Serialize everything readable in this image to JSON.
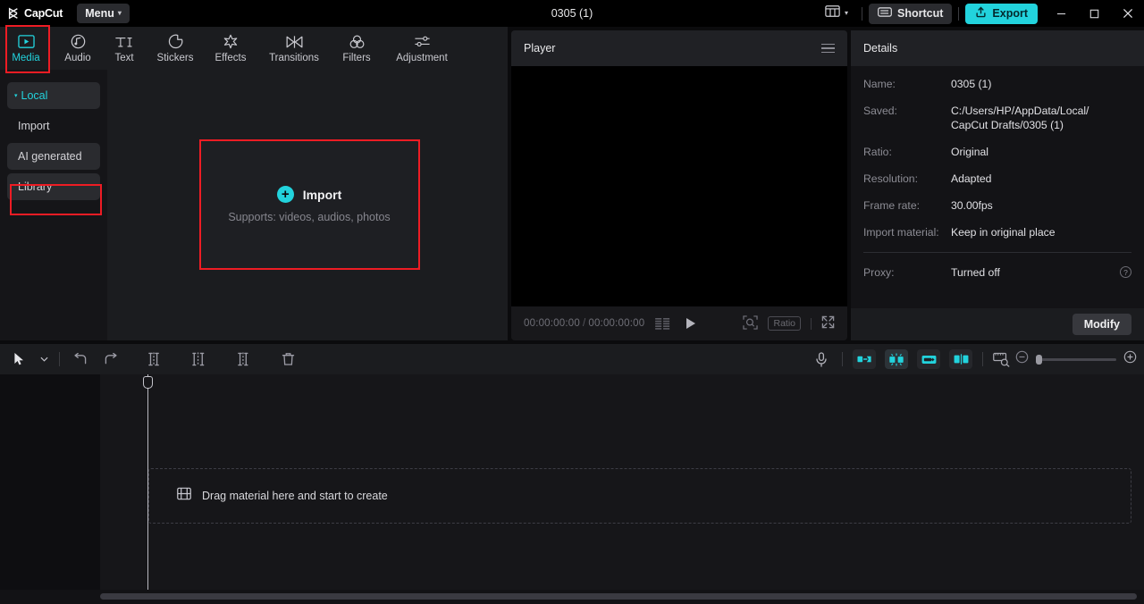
{
  "titlebar": {
    "brand": "CapCut",
    "menu_label": "Menu",
    "project_title": "0305 (1)",
    "layout_icon": "layout-panels-icon",
    "shortcut_label": "Shortcut",
    "export_label": "Export",
    "minimize_label": "–",
    "maximize_label": "□",
    "close_label": "✕"
  },
  "tabs": [
    {
      "label": "Media",
      "icon": "media-play-rect-icon",
      "active": true
    },
    {
      "label": "Audio",
      "icon": "audio-note-icon",
      "active": false
    },
    {
      "label": "Text",
      "icon": "text-ti-icon",
      "active": false
    },
    {
      "label": "Stickers",
      "icon": "sticker-circle-icon",
      "active": false
    },
    {
      "label": "Effects",
      "icon": "effects-sparkle-icon",
      "active": false
    },
    {
      "label": "Transitions",
      "icon": "transitions-bowtie-icon",
      "active": false
    },
    {
      "label": "Filters",
      "icon": "filters-circles-icon",
      "active": false
    },
    {
      "label": "Adjustment",
      "icon": "adjustment-sliders-icon",
      "active": false
    }
  ],
  "sidebar": {
    "items": [
      {
        "label": "Local",
        "name": "sidebar-item-local",
        "selected": true,
        "accent": true,
        "caret": "▾"
      },
      {
        "label": "Import",
        "name": "sidebar-item-import",
        "selected": false,
        "accent": false
      },
      {
        "label": "AI generated",
        "name": "sidebar-item-ai-generated",
        "selected": true,
        "accent": false
      },
      {
        "label": "Library",
        "name": "sidebar-item-library",
        "selected": true,
        "accent": false
      }
    ]
  },
  "media": {
    "dropzone": {
      "plus": "+",
      "title": "Import",
      "subtitle": "Supports: videos, audios, photos"
    }
  },
  "player": {
    "title": "Player",
    "menu_icon": "hamburger-menu-icon",
    "current_time": "00:00:00:00",
    "separator": "/",
    "total_time": "00:00:00:00",
    "grid_icon": "frames-grid-icon",
    "play_icon": "play-icon",
    "magnify_icon": "magnifier-frame-icon",
    "ratio_label": "Ratio",
    "fullscreen_icon": "fullscreen-icon"
  },
  "details": {
    "title": "Details",
    "rows": [
      {
        "label": "Name:",
        "value": "0305 (1)"
      },
      {
        "label": "Saved:",
        "value": "C:/Users/HP/AppData/Local/\nCapCut Drafts/0305 (1)"
      },
      {
        "label": "Ratio:",
        "value": "Original"
      },
      {
        "label": "Resolution:",
        "value": "Adapted"
      },
      {
        "label": "Frame rate:",
        "value": "30.00fps"
      },
      {
        "label": "Import material:",
        "value": "Keep in original place"
      }
    ],
    "proxy": {
      "label": "Proxy:",
      "value": "Turned off",
      "help_icon": "help-question-icon",
      "help_glyph": "?"
    },
    "modify_label": "Modify"
  },
  "timeline_toolbar": {
    "left_icons": [
      {
        "name": "select-cursor-icon"
      },
      {
        "name": "cursor-dropdown-caret-icon"
      },
      {
        "name": "undo-icon"
      },
      {
        "name": "redo-icon"
      },
      {
        "name": "split-icon"
      },
      {
        "name": "trim-left-icon"
      },
      {
        "name": "trim-right-icon"
      },
      {
        "name": "delete-icon"
      }
    ],
    "right_icons": [
      {
        "name": "microphone-record-icon"
      },
      {
        "name": "auto-cut-icon"
      },
      {
        "name": "auto-reframe-icon"
      },
      {
        "name": "link-clip-icon"
      },
      {
        "name": "mirror-split-icon"
      },
      {
        "name": "zoom-to-fit-icon"
      },
      {
        "name": "zoom-out-icon"
      },
      {
        "name": "zoom-in-icon"
      }
    ]
  },
  "timeline": {
    "drop_icon": "film-strip-icon",
    "drop_text": "Drag material here and start to create",
    "playhead_position": "0"
  },
  "colors": {
    "accent": "#22d3dd",
    "annotation": "#ee1c24",
    "panel_bg": "#1b1c1f",
    "window_bg": "#0b0b0d",
    "dark_bg": "#131316"
  },
  "annotations": [
    {
      "name": "annotation-box-media-tab",
      "target": "Media"
    },
    {
      "name": "annotation-box-library",
      "target": "Library"
    },
    {
      "name": "annotation-box-import",
      "target": "Import dropzone"
    }
  ]
}
